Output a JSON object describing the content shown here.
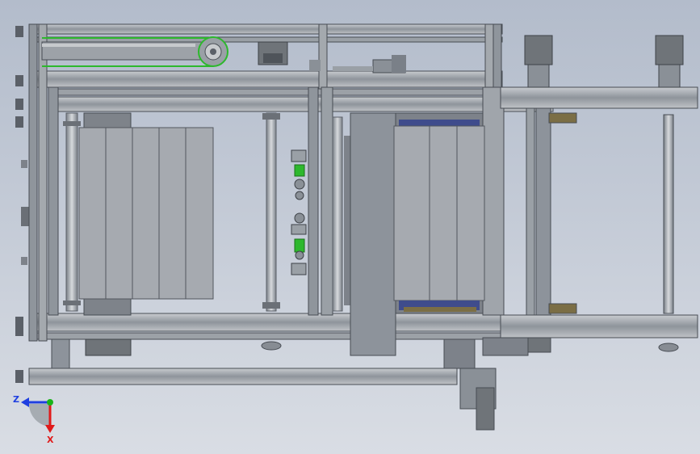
{
  "viewport": {
    "background_top": "#b3bccb",
    "background_bottom": "#d9dde4"
  },
  "triad": {
    "z_label": "Z",
    "x_label": "X",
    "z_color": "#1f3fe0",
    "x_color": "#e01a1a",
    "y_color": "#19b319"
  },
  "colors": {
    "frame": "#8d939b",
    "frame_dark": "#565c64",
    "panel": "#a6aab0",
    "panel_light": "#b7bbc0",
    "motor": "#6f7479",
    "green_part": "#2db82d",
    "pallet_blue": "#3f4c8c",
    "brown_strip": "#7b6e45"
  }
}
